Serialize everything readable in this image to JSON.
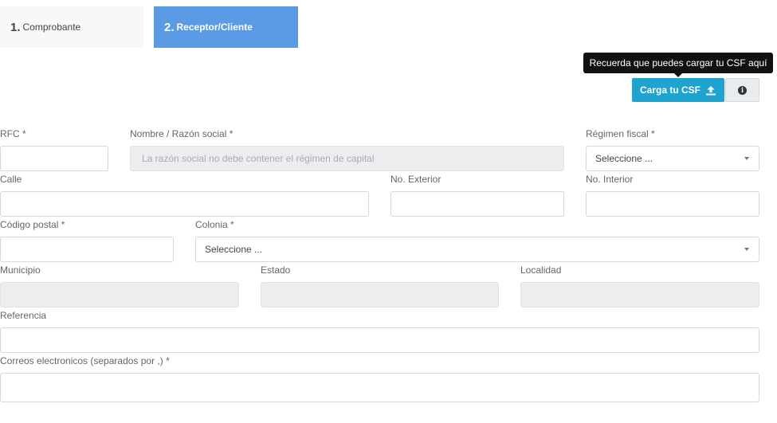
{
  "tabs": [
    {
      "number": "1.",
      "label": "Comprobante"
    },
    {
      "number": "2.",
      "label": "Receptor/Cliente"
    }
  ],
  "tooltip": "Recuerda que puedes cargar tu CSF aquí",
  "upload_button": {
    "label": "Carga tu CSF",
    "icon": "upload-icon"
  },
  "info_button": {
    "icon": "info-icon"
  },
  "fields": {
    "rfc": {
      "label": "RFC *",
      "value": ""
    },
    "razon_social": {
      "label": "Nombre / Razón social *",
      "placeholder": "La razón social no debe  contener el régimen de capital"
    },
    "regimen": {
      "label": "Régimen fiscal *",
      "selected": "Seleccione ..."
    },
    "calle": {
      "label": "Calle",
      "value": ""
    },
    "no_exterior": {
      "label": "No. Exterior",
      "value": ""
    },
    "no_interior": {
      "label": "No. Interior",
      "value": ""
    },
    "codigo_postal": {
      "label": "Código postal *",
      "value": ""
    },
    "colonia": {
      "label": "Colonia *",
      "selected": "Seleccione ..."
    },
    "municipio": {
      "label": "Municipio",
      "value": ""
    },
    "estado": {
      "label": "Estado",
      "value": ""
    },
    "localidad": {
      "label": "Localidad",
      "value": ""
    },
    "referencia": {
      "label": "Referencia",
      "value": ""
    },
    "correos": {
      "label": "Correos electronicos (separados por ,) *",
      "value": ""
    }
  },
  "colors": {
    "active_tab": "#5b9be6",
    "upload_button": "#1fa3d0",
    "tooltip_bg": "#111111"
  }
}
